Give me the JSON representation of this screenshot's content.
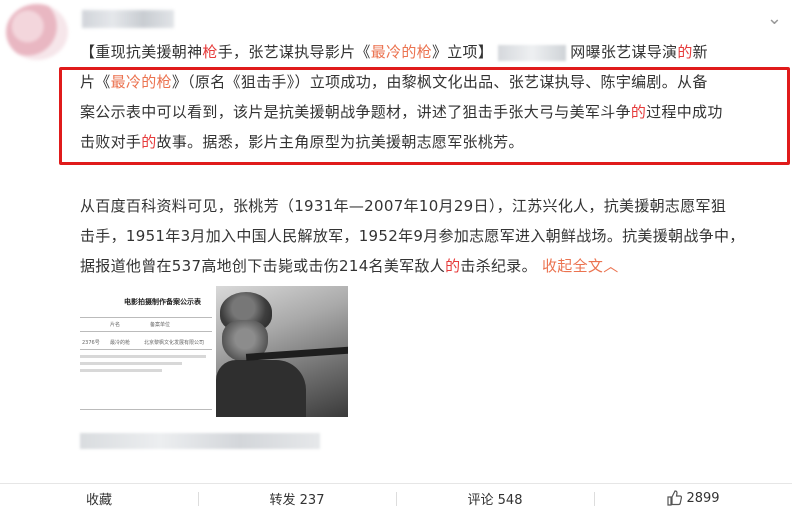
{
  "post": {
    "line1": {
      "tag": "【重现抗美援朝神",
      "tag_red": "枪",
      "tag_rest": "手，张艺谋执导影片《",
      "film_link": "最冷的枪",
      "tag_end": "》立项】",
      "after_blur": "网曝张艺谋导演",
      "de": "的",
      "xin": "新"
    },
    "box_line1": {
      "a": "片《",
      "link": "最冷的枪",
      "b": "》（原名《狙击手》）立项成功，由黎枫文化出品、张艺谋执导、陈宇编剧。从备"
    },
    "box_line2": {
      "a": "案公示表中可以看到，该片是抗美援朝战争题材，讲述了狙击手张大弓与美军斗争",
      "de": "的",
      "b": "过程中成功"
    },
    "box_line3": {
      "a": "击败对手",
      "de": "的",
      "b": "故事。据悉，影片主角原型为抗美援朝志愿军张桃芳。"
    },
    "para2_line1": "从百度百科资料可见，张桃芳（1931年—2007年10月29日），江苏兴化人，抗美援朝志愿军狙",
    "para2_line2": "击手，1951年3月加入中国人民解放军，1952年9月参加志愿军进入朝鲜战场。抗美援朝战争中，",
    "para2_line3": {
      "a": "据报道他曾在537高地创下击毙或击伤214名美军敌人",
      "de": "的",
      "b": "击杀纪录。",
      "collapse": "收起全文"
    }
  },
  "doc_image": {
    "title": "电影拍摄制作备案公示表",
    "col2": "片名",
    "col3": "备案单位",
    "row1_c1": "2376号",
    "row1_c2": "最冷的枪",
    "row1_c3": "北京黎枫文化发展有限公司"
  },
  "actions": {
    "collect": "收藏",
    "repost": "转发 237",
    "comment": "评论 548",
    "like": "2899"
  },
  "colors": {
    "link": "#eb7350",
    "red": "#e63b3b",
    "box": "#e01b1b"
  }
}
